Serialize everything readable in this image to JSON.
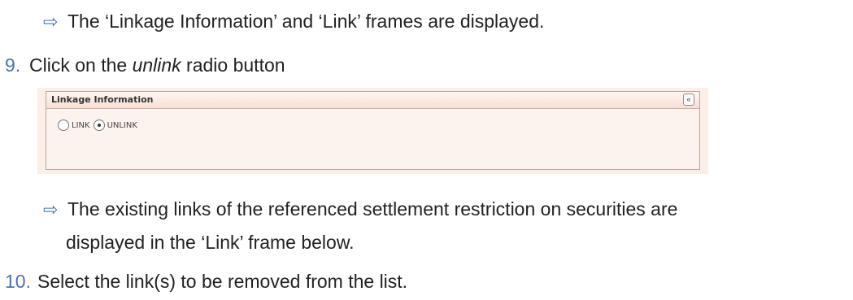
{
  "result_1": "The ‘Linkage Information’ and ‘Link’ frames are displayed.",
  "step_9": {
    "number": "9.",
    "text_before": "Click on the ",
    "text_italic": "unlink",
    "text_after": " radio button"
  },
  "linkage_panel": {
    "title": "Linkage Information",
    "collapse_glyph": "«",
    "options": [
      {
        "label": "LINK",
        "checked": false
      },
      {
        "label": "UNLINK",
        "checked": true
      }
    ]
  },
  "result_2": {
    "line1": "The existing links of the referenced settlement restriction on securities are",
    "line2": "displayed in the ‘Link’ frame below."
  },
  "step_10": {
    "number": "10.",
    "text": "Select the link(s) to be removed from the list."
  },
  "colors": {
    "step_number": "#4a73b5",
    "panel_bg": "#fcefe8"
  }
}
